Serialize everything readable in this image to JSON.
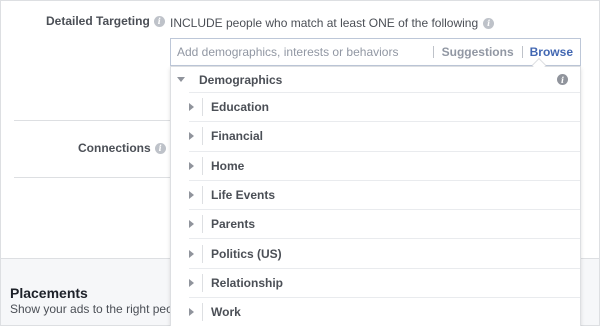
{
  "targeting": {
    "label": "Detailed Targeting",
    "include_text": "INCLUDE people who match at least ONE of the following",
    "search_placeholder": "Add demographics, interests or behaviors",
    "suggestions_label": "Suggestions",
    "browse_label": "Browse"
  },
  "connections": {
    "label": "Connections"
  },
  "dropdown": {
    "category": "Demographics",
    "items": [
      {
        "label": "Education"
      },
      {
        "label": "Financial"
      },
      {
        "label": "Home"
      },
      {
        "label": "Life Events"
      },
      {
        "label": "Parents"
      },
      {
        "label": "Politics (US)"
      },
      {
        "label": "Relationship"
      },
      {
        "label": "Work"
      }
    ]
  },
  "placements": {
    "title": "Placements",
    "description": "Show your ads to the right peo"
  },
  "colors": {
    "accent": "#4267b2",
    "muted": "#9197a3",
    "text": "#4b4f56",
    "border": "#dddfe2"
  }
}
